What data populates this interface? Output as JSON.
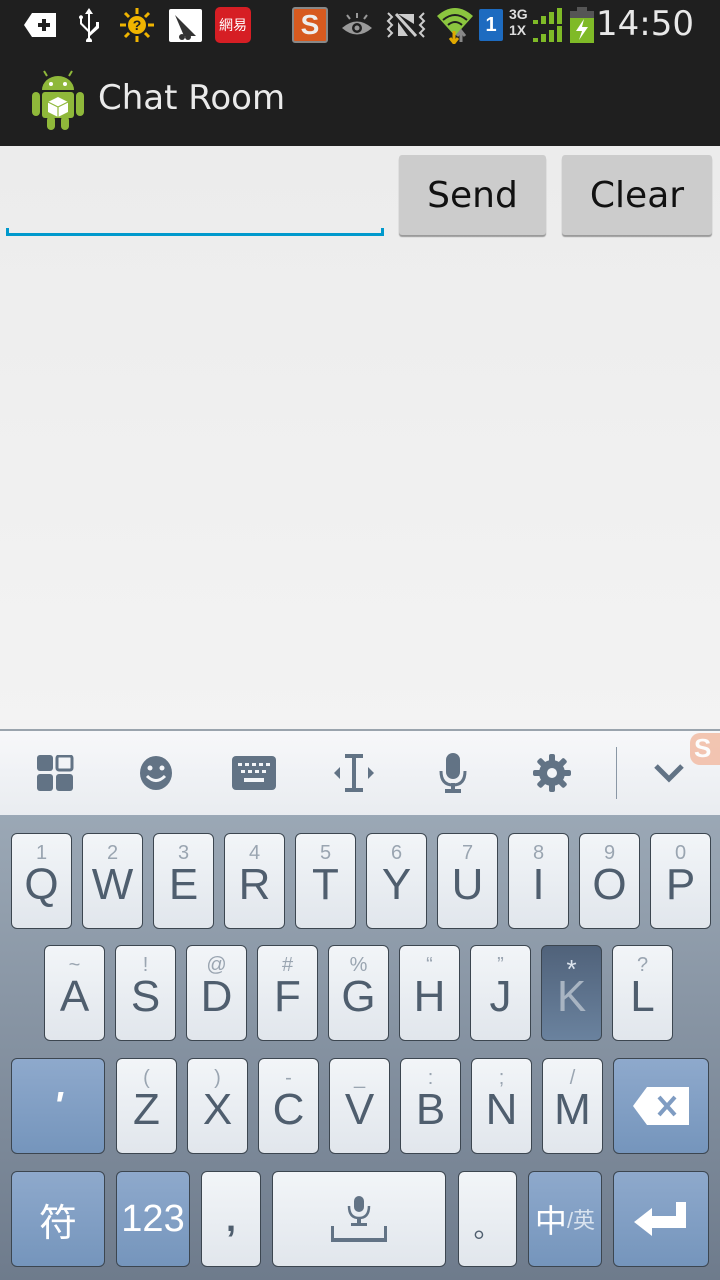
{
  "status_bar": {
    "time": "14:50",
    "icons": [
      "add-notification-icon",
      "usb-icon",
      "brightness-question-icon",
      "satellite-dish-app-icon",
      "netease-app-icon",
      "sogou-input-icon",
      "eye-icon",
      "vibrate-mute-icon",
      "wifi-icon",
      "sim-1-icon",
      "signal-3g-1x-icon",
      "battery-charging-icon"
    ],
    "netease_label": "網易",
    "sim_label": "1",
    "net_top": "3G",
    "net_bottom": "1X"
  },
  "action_bar": {
    "title": "Chat Room",
    "icon": "android-app-icon"
  },
  "compose": {
    "input_value": "",
    "input_placeholder": "",
    "send_label": "Send",
    "clear_label": "Clear"
  },
  "keyboard": {
    "toolbar": [
      "apps-grid-icon",
      "emoji-icon",
      "keyboard-icon",
      "cursor-icon",
      "microphone-icon",
      "settings-gear-icon",
      "collapse-chevron-icon"
    ],
    "row1": [
      {
        "main": "Q",
        "sub": "1"
      },
      {
        "main": "W",
        "sub": "2"
      },
      {
        "main": "E",
        "sub": "3"
      },
      {
        "main": "R",
        "sub": "4"
      },
      {
        "main": "T",
        "sub": "5"
      },
      {
        "main": "Y",
        "sub": "6"
      },
      {
        "main": "U",
        "sub": "7"
      },
      {
        "main": "I",
        "sub": "8"
      },
      {
        "main": "O",
        "sub": "9"
      },
      {
        "main": "P",
        "sub": "0"
      }
    ],
    "row2": [
      {
        "main": "A",
        "sub": "~"
      },
      {
        "main": "S",
        "sub": "!"
      },
      {
        "main": "D",
        "sub": "@"
      },
      {
        "main": "F",
        "sub": "#"
      },
      {
        "main": "G",
        "sub": "%"
      },
      {
        "main": "H",
        "sub": "“"
      },
      {
        "main": "J",
        "sub": "”"
      },
      {
        "main": "K",
        "sub": "*",
        "pressed": true
      },
      {
        "main": "L",
        "sub": "?"
      }
    ],
    "row3": [
      {
        "main": "Z",
        "sub": "("
      },
      {
        "main": "X",
        "sub": ")"
      },
      {
        "main": "C",
        "sub": "-"
      },
      {
        "main": "V",
        "sub": "_"
      },
      {
        "main": "B",
        "sub": ":"
      },
      {
        "main": "N",
        "sub": ";"
      },
      {
        "main": "M",
        "sub": "/"
      }
    ],
    "apostrophe_label": "'",
    "symbols_label": "符",
    "numbers_label": "123",
    "comma_label": ",",
    "period_label": "。",
    "lang_main": "中",
    "lang_sub": "/英"
  }
}
